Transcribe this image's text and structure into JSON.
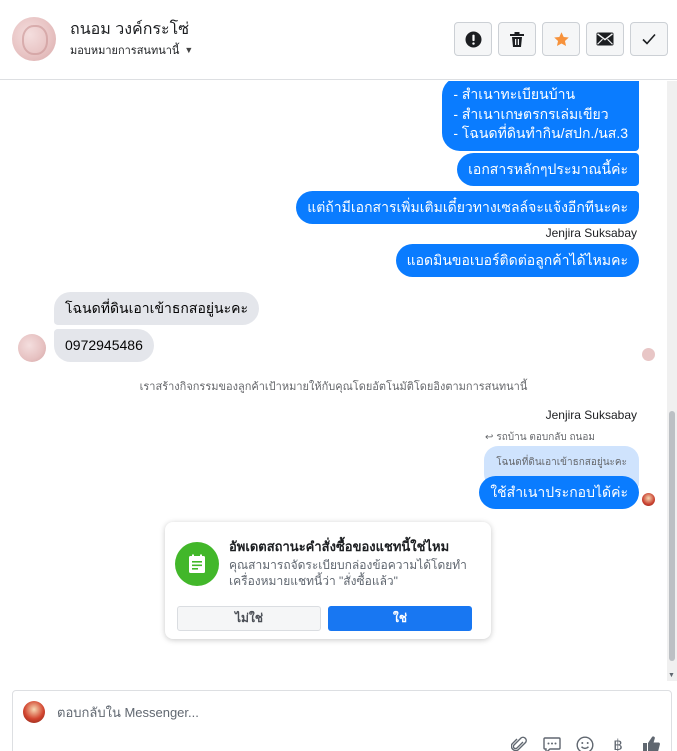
{
  "header": {
    "contact_name": "ถนอม วงค์กระโซ่",
    "assign_label": "มอบหมายการสนทนานี้",
    "buttons": [
      "mark-spam",
      "delete",
      "star",
      "mark-unread",
      "mark-done"
    ]
  },
  "messages": {
    "list_items": [
      "- สำเนาทะเบียนบ้าน",
      "- สำเนาเกษตรกรเล่มเขียว",
      "- โฉนดที่ดินทำกิน/สปก./นส.3"
    ],
    "out_1": "เอกสารหลักๆประมาณนี้ค่ะ",
    "out_2": "แต่ถ้ามีเอกสารเพิ่มเติมเดี๋ยวทางเซลล์จะแจ้งอีกทีนะคะ",
    "sender_1": "Jenjira Suksabay",
    "out_3": "แอดมินขอเบอร์ติดต่อลูกค้าได้ไหมคะ",
    "in_1": "โฉนดที่ดินเอาเข้าธกสอยู่นะคะ",
    "in_2": "0972945486",
    "system_note": "เราสร้างกิจกรรมของลูกค้าเป้าหมายให้กับคุณโดยอัตโนมัติโดยอิงตามการสนทนานี้",
    "sender_2": "Jenjira Suksabay",
    "reply_meta": "รถบ้าน ตอบกลับ ถนอม",
    "quoted": "โฉนดที่ดินเอาเข้าธกสอยู่นะคะ",
    "out_4": "ใช้สำเนาประกอบได้ค่ะ"
  },
  "status_card": {
    "title": "อัพเดตสถานะคำสั่งซื้อของแชทนี้ใช่ไหม",
    "body": "คุณสามารถจัดระเบียบกล่องข้อความได้โดยทำเครื่องหมายแชทนี้ว่า \"สั่งซื้อแล้ว\"",
    "no_label": "ไม่ใช่",
    "yes_label": "ใช่"
  },
  "composer": {
    "placeholder": "ตอบกลับใน Messenger...",
    "tools": [
      "attach-icon",
      "saved-replies-icon",
      "emoji-icon",
      "baht-icon",
      "like-icon"
    ],
    "baht_glyph": "฿"
  },
  "colors": {
    "outgoing": "#0a7cff",
    "incoming": "#e4e6eb",
    "quoted": "#cfe3fd",
    "card_icon": "#42b72a",
    "primary_button": "#1877f2",
    "star": "#f7923b"
  }
}
